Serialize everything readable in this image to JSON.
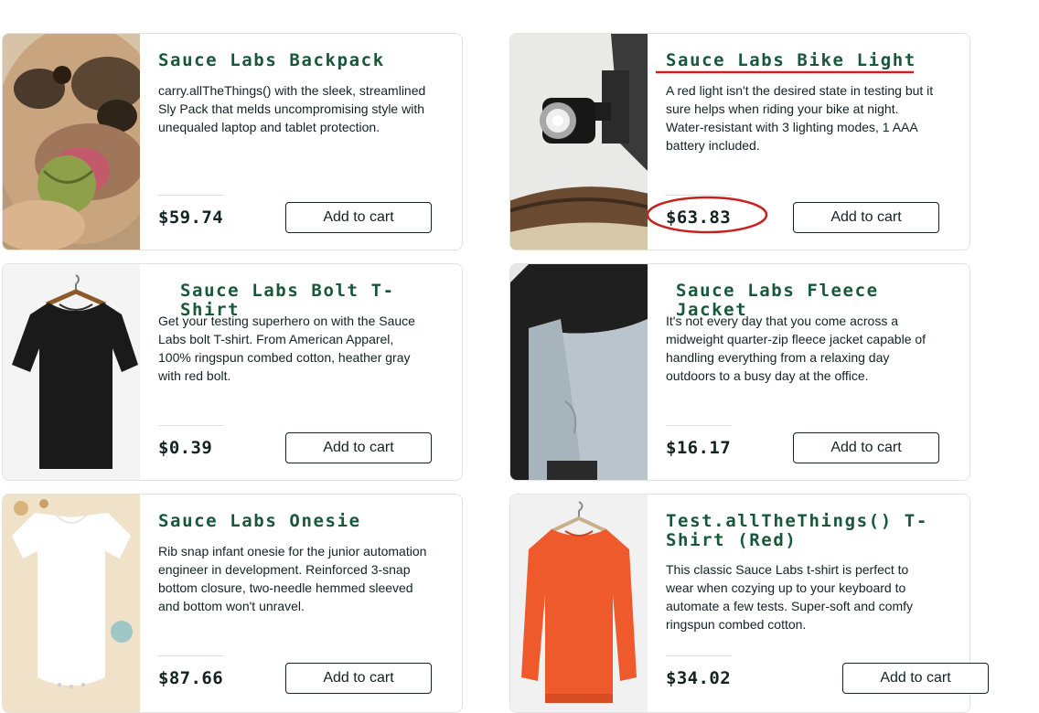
{
  "products": [
    {
      "name": "Sauce Labs Backpack",
      "description": "carry.allTheThings() with the sleek, streamlined Sly Pack that melds uncompromising style with unequaled laptop and tablet protection.",
      "price": "$59.74",
      "button": "Add to cart",
      "image": "backpack-dog-photo"
    },
    {
      "name": "Sauce Labs Bike Light",
      "description": "A red light isn't the desired state in testing but it sure helps when riding your bike at night. Water-resistant with 3 lighting modes, 1 AAA battery included.",
      "price": "$63.83",
      "button": "Add to cart",
      "image": "bike-light-photo"
    },
    {
      "name": "Sauce Labs Bolt T-Shirt",
      "description": "Get your testing superhero on with the Sauce Labs bolt T-shirt. From American Apparel, 100% ringspun combed cotton, heather gray with red bolt.",
      "price": "$0.39",
      "button": "Add to cart",
      "image": "black-tshirt-photo"
    },
    {
      "name": "Sauce Labs Fleece Jacket",
      "description": "It's not every day that you come across a midweight quarter-zip fleece jacket capable of handling everything from a relaxing day outdoors to a busy day at the office.",
      "price": "$16.17",
      "button": "Add to cart",
      "image": "fleece-jacket-photo"
    },
    {
      "name": "Sauce Labs Onesie",
      "description": "Rib snap infant onesie for the junior automation engineer in development. Reinforced 3-snap bottom closure, two-needle hemmed sleeved and bottom won't unravel.",
      "price": "$87.66",
      "button": "Add to cart",
      "image": "onesie-photo"
    },
    {
      "name": "Test.allTheThings() T-Shirt (Red)",
      "description": "This classic Sauce Labs t-shirt is perfect to wear when cozying up to your keyboard to automate a few tests. Super-soft and comfy ringspun combed cotton.",
      "price": "$34.02",
      "button": "Add to cart",
      "image": "red-sweatshirt-photo"
    }
  ],
  "colors": {
    "product_name": "#18583a",
    "text": "#132322",
    "border": "#e2e2e2",
    "annotation": "#c8211d"
  }
}
